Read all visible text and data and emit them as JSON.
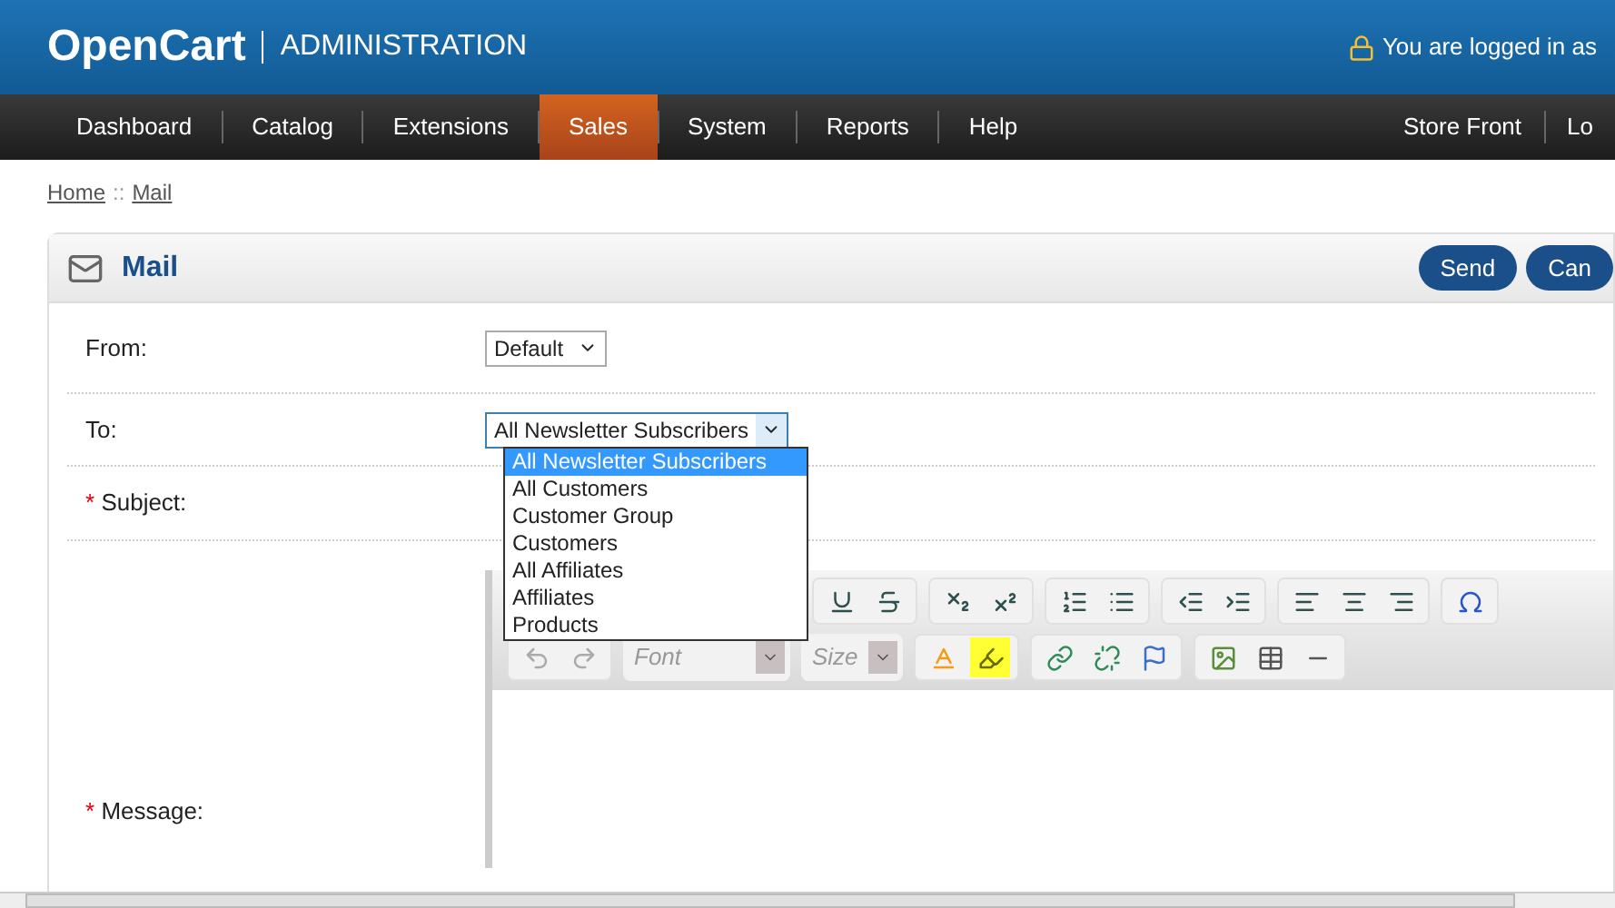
{
  "header": {
    "logo": "OpenCart",
    "subtitle": "ADMINISTRATION",
    "login_text": "You are logged in as"
  },
  "nav": {
    "items": [
      {
        "label": "Dashboard",
        "selected": false
      },
      {
        "label": "Catalog",
        "selected": false
      },
      {
        "label": "Extensions",
        "selected": false
      },
      {
        "label": "Sales",
        "selected": true
      },
      {
        "label": "System",
        "selected": false
      },
      {
        "label": "Reports",
        "selected": false
      },
      {
        "label": "Help",
        "selected": false
      }
    ],
    "right_items": [
      "Store Front",
      "Lo"
    ]
  },
  "breadcrumb": {
    "links": [
      "Home",
      "Mail"
    ],
    "separator": "::"
  },
  "panel": {
    "title": "Mail",
    "buttons": [
      "Send",
      "Can"
    ]
  },
  "form": {
    "from": {
      "label": "From:",
      "value": "Default"
    },
    "to": {
      "label": "To:",
      "value": "All Newsletter Subscribers",
      "expanded": true,
      "options": [
        {
          "label": "All Newsletter Subscribers",
          "selected": true
        },
        {
          "label": "All Customers",
          "selected": false
        },
        {
          "label": "Customer Group",
          "selected": false
        },
        {
          "label": "Customers",
          "selected": false
        },
        {
          "label": "All Affiliates",
          "selected": false
        },
        {
          "label": "Affiliates",
          "selected": false
        },
        {
          "label": "Products",
          "selected": false
        }
      ]
    },
    "subject": {
      "mark": "*",
      "label": "Subject:"
    },
    "message": {
      "mark": "*",
      "label": "Message:"
    }
  },
  "editor": {
    "font_placeholder": "Font",
    "size_placeholder": "Size"
  }
}
